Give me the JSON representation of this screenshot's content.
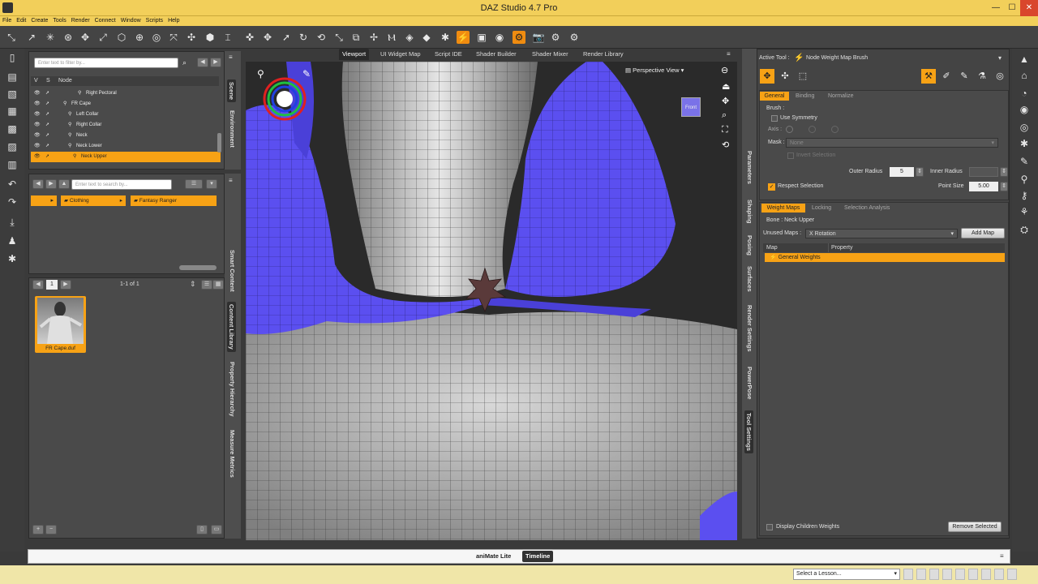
{
  "app": {
    "title": "DAZ Studio 4.7 Pro"
  },
  "menu": [
    "File",
    "Edit",
    "Create",
    "Tools",
    "Render",
    "Connect",
    "Window",
    "Scripts",
    "Help"
  ],
  "scene": {
    "filter_placeholder": "Enter text to filter by...",
    "cols": {
      "v": "V",
      "s": "S",
      "node": "Node"
    },
    "rows": [
      {
        "label": "Right Pectoral",
        "indent": 68
      },
      {
        "label": "FR Cape",
        "indent": 50
      },
      {
        "label": "Left Collar",
        "indent": 56
      },
      {
        "label": "Right Collar",
        "indent": 56
      },
      {
        "label": "Neck",
        "indent": 56
      },
      {
        "label": "Neck Lower",
        "indent": 56
      },
      {
        "label": "Neck Upper",
        "indent": 62,
        "selected": true
      }
    ]
  },
  "left_tabs": [
    "Scene",
    "Environment",
    "Smart Content",
    "Content Library",
    "Property Hierarchy",
    "Measure Metrics"
  ],
  "content": {
    "search_placeholder": "Enter text to search by...",
    "paths": [
      "Clothing",
      "Fantasy Ranger"
    ],
    "page": "1",
    "page_count": "1-1 of 1",
    "item": "FR Cape.duf"
  },
  "viewport": {
    "tabs": [
      "Viewport",
      "UI Widget Map",
      "Script IDE",
      "Shader Builder",
      "Shader Mixer",
      "Render Library"
    ],
    "view_label": "Perspective View",
    "cube_label": "Front"
  },
  "right_tabs": [
    "Parameters",
    "Shaping",
    "Posing",
    "Surfaces",
    "Render Settings",
    "PowerPose",
    "Tool Settings"
  ],
  "tool": {
    "active_label": "Active Tool :",
    "name": "Node Weight Map Brush",
    "subtabs": [
      "General",
      "Binding",
      "Normalize"
    ],
    "brush_label": "Brush :",
    "use_symmetry": "Use Symmetry",
    "axis_label": "Axis :",
    "mask_label": "Mask :",
    "mask_value": "None",
    "invert": "Invert Selection",
    "outer_radius_label": "Outer Radius",
    "outer_radius": "5",
    "inner_radius_label": "Inner Radius",
    "respect_selection": "Respect Selection",
    "point_size_label": "Point Size",
    "point_size": "5.00",
    "wm_tabs": [
      "Weight Maps",
      "Locking",
      "Selection Analysis"
    ],
    "bone_label": "Bone : Neck Upper",
    "unused_maps_label": "Unused Maps :",
    "unused_maps_value": "X Rotation",
    "add_map": "Add Map",
    "col_map": "Map",
    "col_property": "Property",
    "map_row": "General Weights",
    "display_children": "Display Children Weights",
    "remove_selected": "Remove Selected"
  },
  "bottom": {
    "animate": "aniMate Lite",
    "timeline": "Timeline",
    "lesson": "Select a Lesson..."
  },
  "colors": {
    "accent": "#f7a215",
    "title": "#f2cf5a",
    "cape": "#5b4ff0"
  }
}
